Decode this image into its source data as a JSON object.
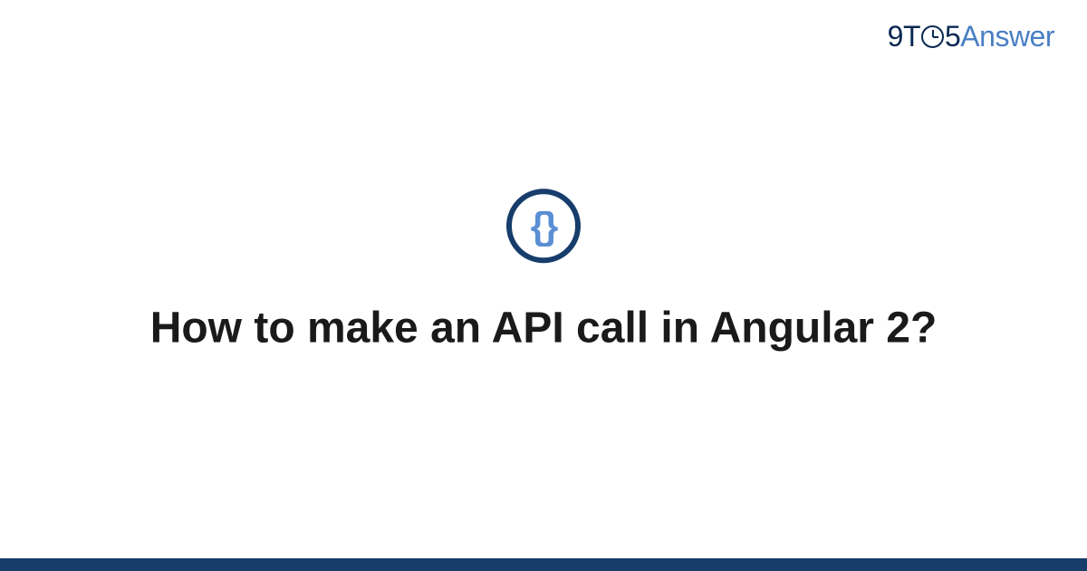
{
  "logo": {
    "part1": "9T",
    "part2": "5",
    "part3": "Answer"
  },
  "category_icon": {
    "name": "code-braces-icon",
    "glyph_left": "{",
    "glyph_right": "}"
  },
  "title": "How to make an API call in Angular 2?",
  "colors": {
    "dark_blue": "#163d6b",
    "light_blue": "#5a8fd4",
    "logo_dark": "#0a2952",
    "logo_light": "#4a7fc4"
  }
}
